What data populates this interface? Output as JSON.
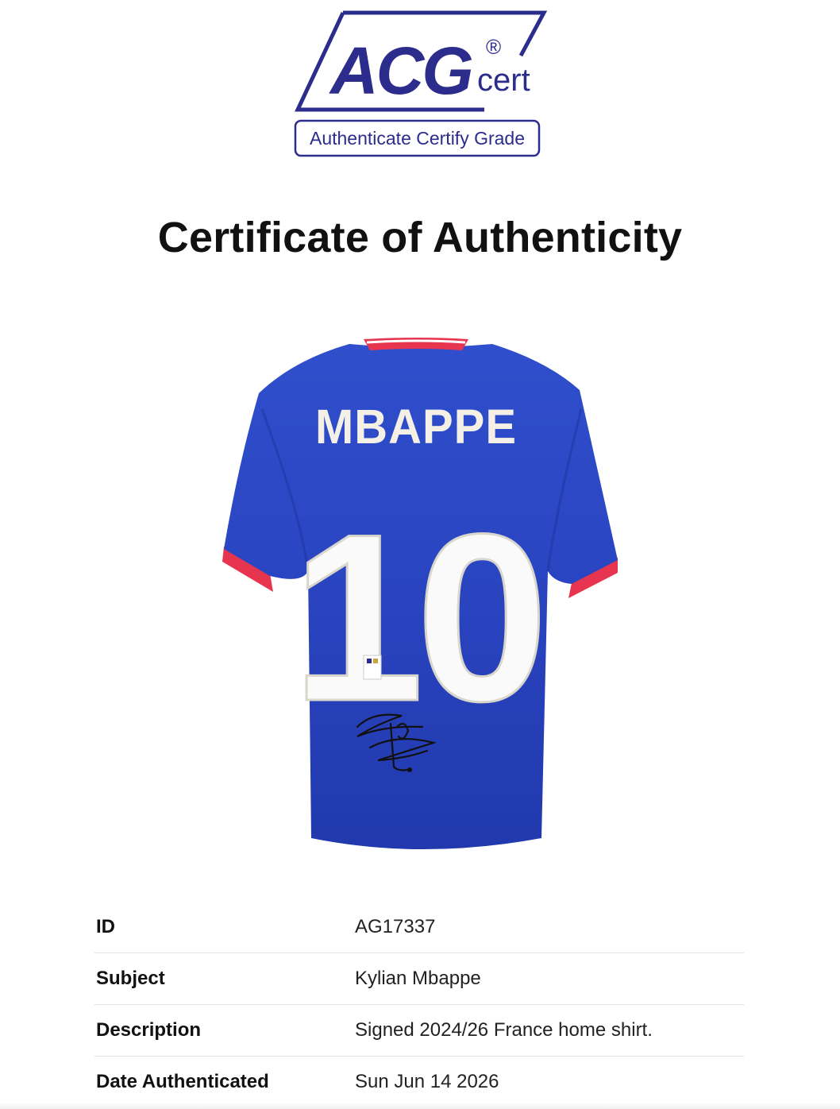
{
  "logo": {
    "brand": "ACG",
    "registered": "®",
    "suffix": "cert",
    "tagline": "Authenticate Certify Grade",
    "color": "#2b2c8c"
  },
  "title": "Certificate of Authenticity",
  "item_image": {
    "player_name": "MBAPPE",
    "number": "10",
    "shirt_color": "#2a44c0",
    "trim_color": "#e8354f"
  },
  "details": [
    {
      "label": "ID",
      "value": "AG17337"
    },
    {
      "label": "Subject",
      "value": "Kylian Mbappe"
    },
    {
      "label": "Description",
      "value": "Signed 2024/26 France home shirt."
    },
    {
      "label": "Date Authenticated",
      "value": "Sun Jun 14 2026"
    }
  ]
}
